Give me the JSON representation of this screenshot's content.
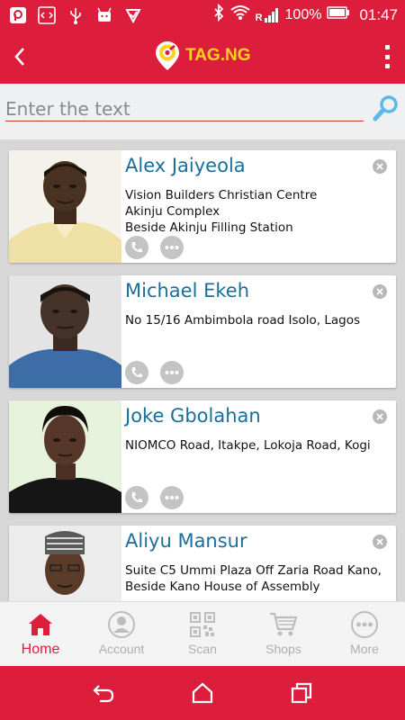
{
  "status_bar": {
    "battery": "100%",
    "time": "01:47",
    "signal_label": "R",
    "left_icons": [
      "app-p-icon",
      "code-icon",
      "usb-icon",
      "android-icon",
      "check-icon"
    ],
    "right_icons": [
      "bluetooth-icon",
      "wifi-icon",
      "signal-icon",
      "battery-icon"
    ]
  },
  "app_bar": {
    "brand": "TAG.NG",
    "back_icon": "chevron-left-icon",
    "menu_icon": "overflow-menu-icon"
  },
  "search": {
    "placeholder": "Enter the text",
    "icon": "search-icon"
  },
  "contacts": [
    {
      "name": "Alex Jaiyeola",
      "address": [
        "Vision Builders Christian Centre",
        "Akinju Complex",
        "Beside Akinju Filling Station"
      ]
    },
    {
      "name": "Michael Ekeh",
      "address": [
        "No 15/16 Ambimbola road Isolo, Lagos"
      ]
    },
    {
      "name": "Joke Gbolahan",
      "address": [
        "NIOMCO Road, Itakpe, Lokoja Road, Kogi"
      ]
    },
    {
      "name": "Aliyu Mansur",
      "address": [
        "Suite C5 Ummi Plaza Off Zaria Road Kano,",
        "Beside Kano House of Assembly"
      ]
    }
  ],
  "bottom_nav": {
    "items": [
      {
        "label": "Home",
        "icon": "home-icon",
        "active": true
      },
      {
        "label": "Account",
        "icon": "account-icon",
        "active": false
      },
      {
        "label": "Scan",
        "icon": "qr-code-icon",
        "active": false
      },
      {
        "label": "Shops",
        "icon": "cart-icon",
        "active": false
      },
      {
        "label": "More",
        "icon": "more-icon",
        "active": false
      }
    ]
  },
  "colors": {
    "primary": "#dc1e3c",
    "brand_text": "#ffd21f",
    "name_text": "#1a6f9a",
    "nav_active": "#dc1e3c",
    "nav_inactive": "#aeaeae"
  }
}
